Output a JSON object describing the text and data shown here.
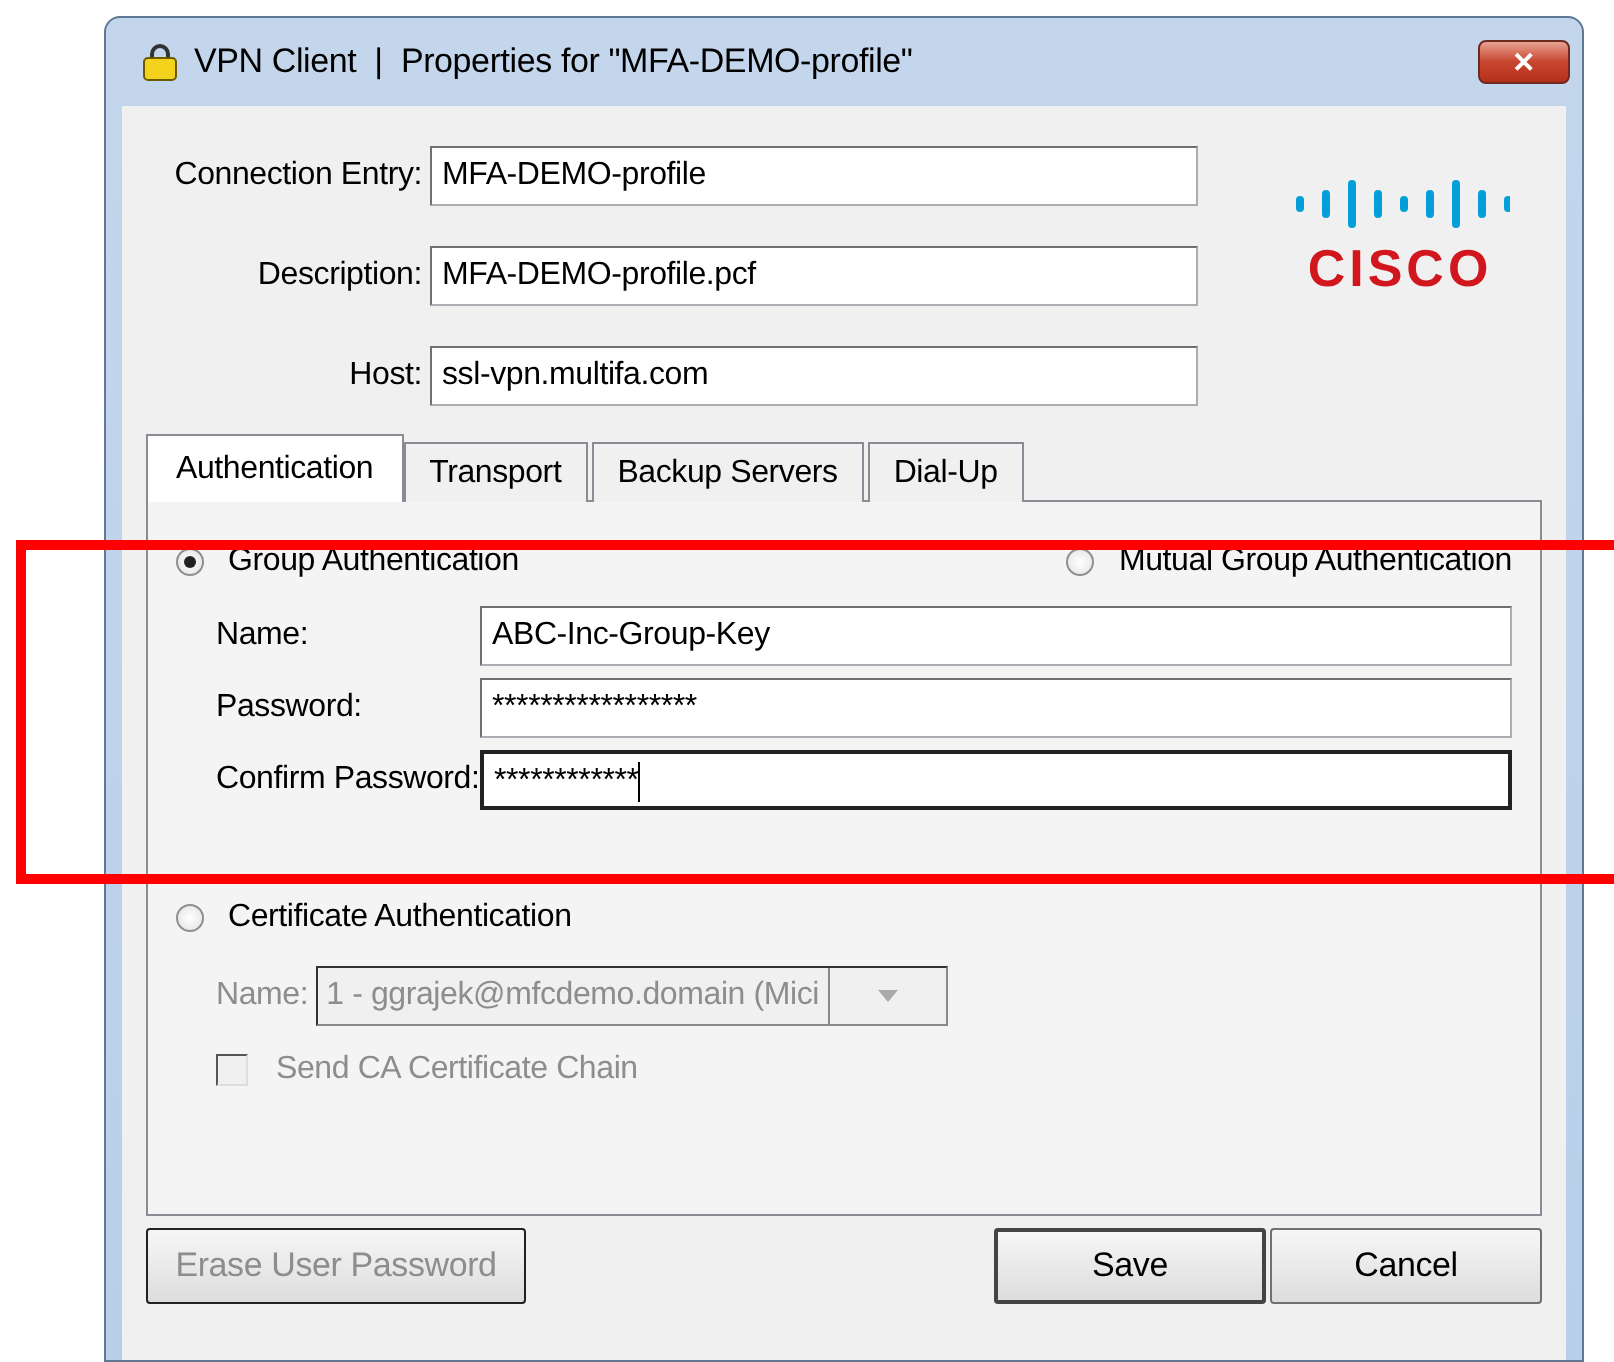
{
  "window": {
    "title": "VPN Client  |  Properties for \"MFA-DEMO-profile\"",
    "close": "✕"
  },
  "fields": [
    {
      "label": "Connection Entry:",
      "value": "MFA-DEMO-profile"
    },
    {
      "label": "Description:",
      "value": "MFA-DEMO-profile.pcf"
    },
    {
      "label": "Host:",
      "value": "ssl-vpn.multifa.com"
    }
  ],
  "logo": {
    "text": "CISCO"
  },
  "tabs": [
    {
      "label": "Authentication",
      "selected": true
    },
    {
      "label": "Transport",
      "selected": false
    },
    {
      "label": "Backup Servers",
      "selected": false
    },
    {
      "label": "Dial-Up",
      "selected": false
    }
  ],
  "group_auth": {
    "highlighted": true,
    "options": [
      {
        "label": "Group Authentication",
        "selected": true
      },
      {
        "label": "Mutual Group Authentication",
        "selected": false
      }
    ],
    "fields": [
      {
        "label": "Name:",
        "value": "ABC-Inc-Group-Key",
        "focused": false
      },
      {
        "label": "Password:",
        "value": "*****************",
        "focused": false
      },
      {
        "label": "Confirm Password:",
        "value": "************",
        "focused": true
      }
    ]
  },
  "cert_auth": {
    "label": "Certificate Authentication",
    "selected": false,
    "name_label": "Name:",
    "name_value": "1 - ggrajek@mfcdemo.domain (Mici",
    "disabled": true,
    "checkbox": {
      "label": "Send CA Certificate Chain",
      "checked": false,
      "disabled": true
    }
  },
  "buttons": [
    {
      "label": "Erase User Password",
      "disabled": true,
      "default": false
    },
    {
      "label": "Save",
      "disabled": false,
      "default": true
    },
    {
      "label": "Cancel",
      "disabled": false,
      "default": false
    }
  ]
}
